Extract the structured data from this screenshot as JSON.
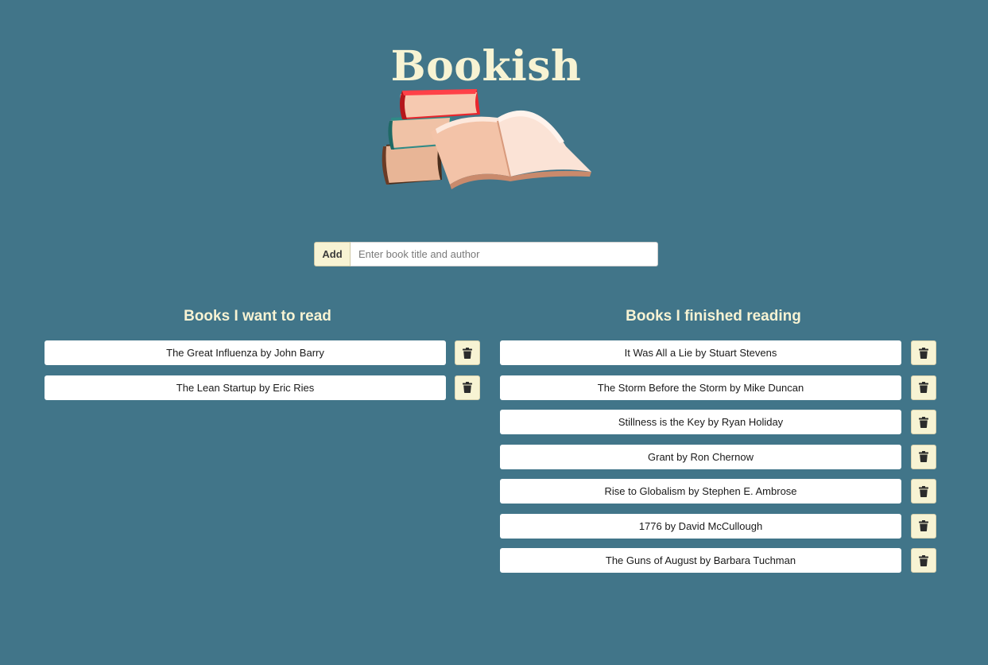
{
  "app": {
    "title": "Bookish"
  },
  "add_form": {
    "button_label": "Add",
    "input_value": "",
    "input_placeholder": "Enter book title and author"
  },
  "want_to_read": {
    "heading": "Books I want to read",
    "books": [
      "The Great Influenza by John Barry",
      "The Lean Startup by Eric Ries"
    ]
  },
  "finished_reading": {
    "heading": "Books I finished reading",
    "books": [
      "It Was All a Lie by Stuart Stevens",
      "The Storm Before the Storm by Mike Duncan",
      "Stillness is the Key by Ryan Holiday",
      "Grant by Ron Chernow",
      "Rise to Globalism by Stephen E. Ambrose",
      "1776 by David McCullough",
      "The Guns of August by Barbara Tuchman"
    ]
  },
  "icons": {
    "hero": "stack-of-books-illustration",
    "delete": "trash-icon"
  },
  "colors": {
    "background": "#417589",
    "accent": "#f7f3d3",
    "row_background": "#ffffff"
  }
}
